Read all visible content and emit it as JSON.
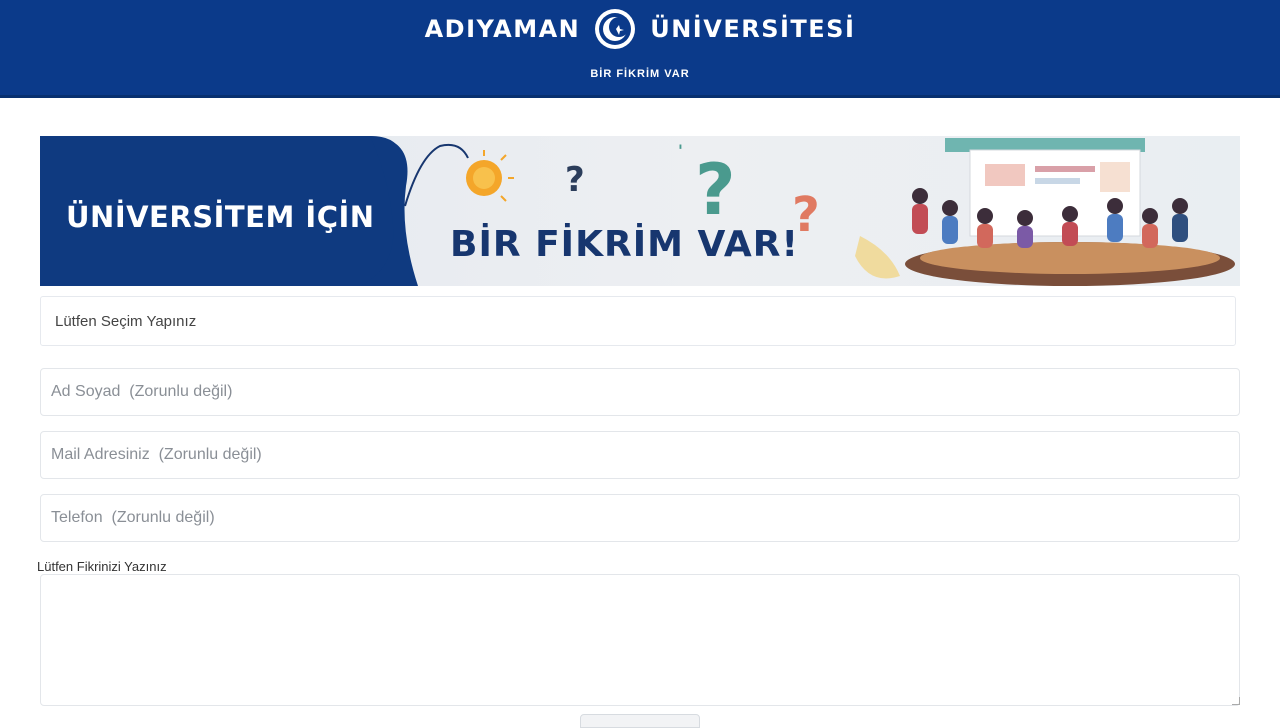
{
  "header": {
    "brand_left": "ADIYAMAN",
    "brand_right": "ÜNİVERSİTESİ",
    "subtitle": "BİR FİKRİM VAR",
    "logo_icon": "crescent-star-logo-icon",
    "background_color": "#0b3a8a"
  },
  "banner": {
    "left_text": "ÜNİVERSİTEM İÇİN",
    "main_text": "BİR FİKRİM VAR!",
    "left_panel_color": "#0f3a80",
    "icons": [
      "lightbulb-icon",
      "question-mark-icon",
      "meeting-illustration"
    ]
  },
  "form": {
    "select_placeholder": "Lütfen Seçim Yapınız",
    "name_placeholder": "Ad Soyad  (Zorunlu değil)",
    "email_placeholder": "Mail Adresiniz  (Zorunlu değil)",
    "phone_placeholder": "Telefon  (Zorunlu değil)",
    "textarea_label": "Lütfen Fikrinizi Yazınız"
  }
}
